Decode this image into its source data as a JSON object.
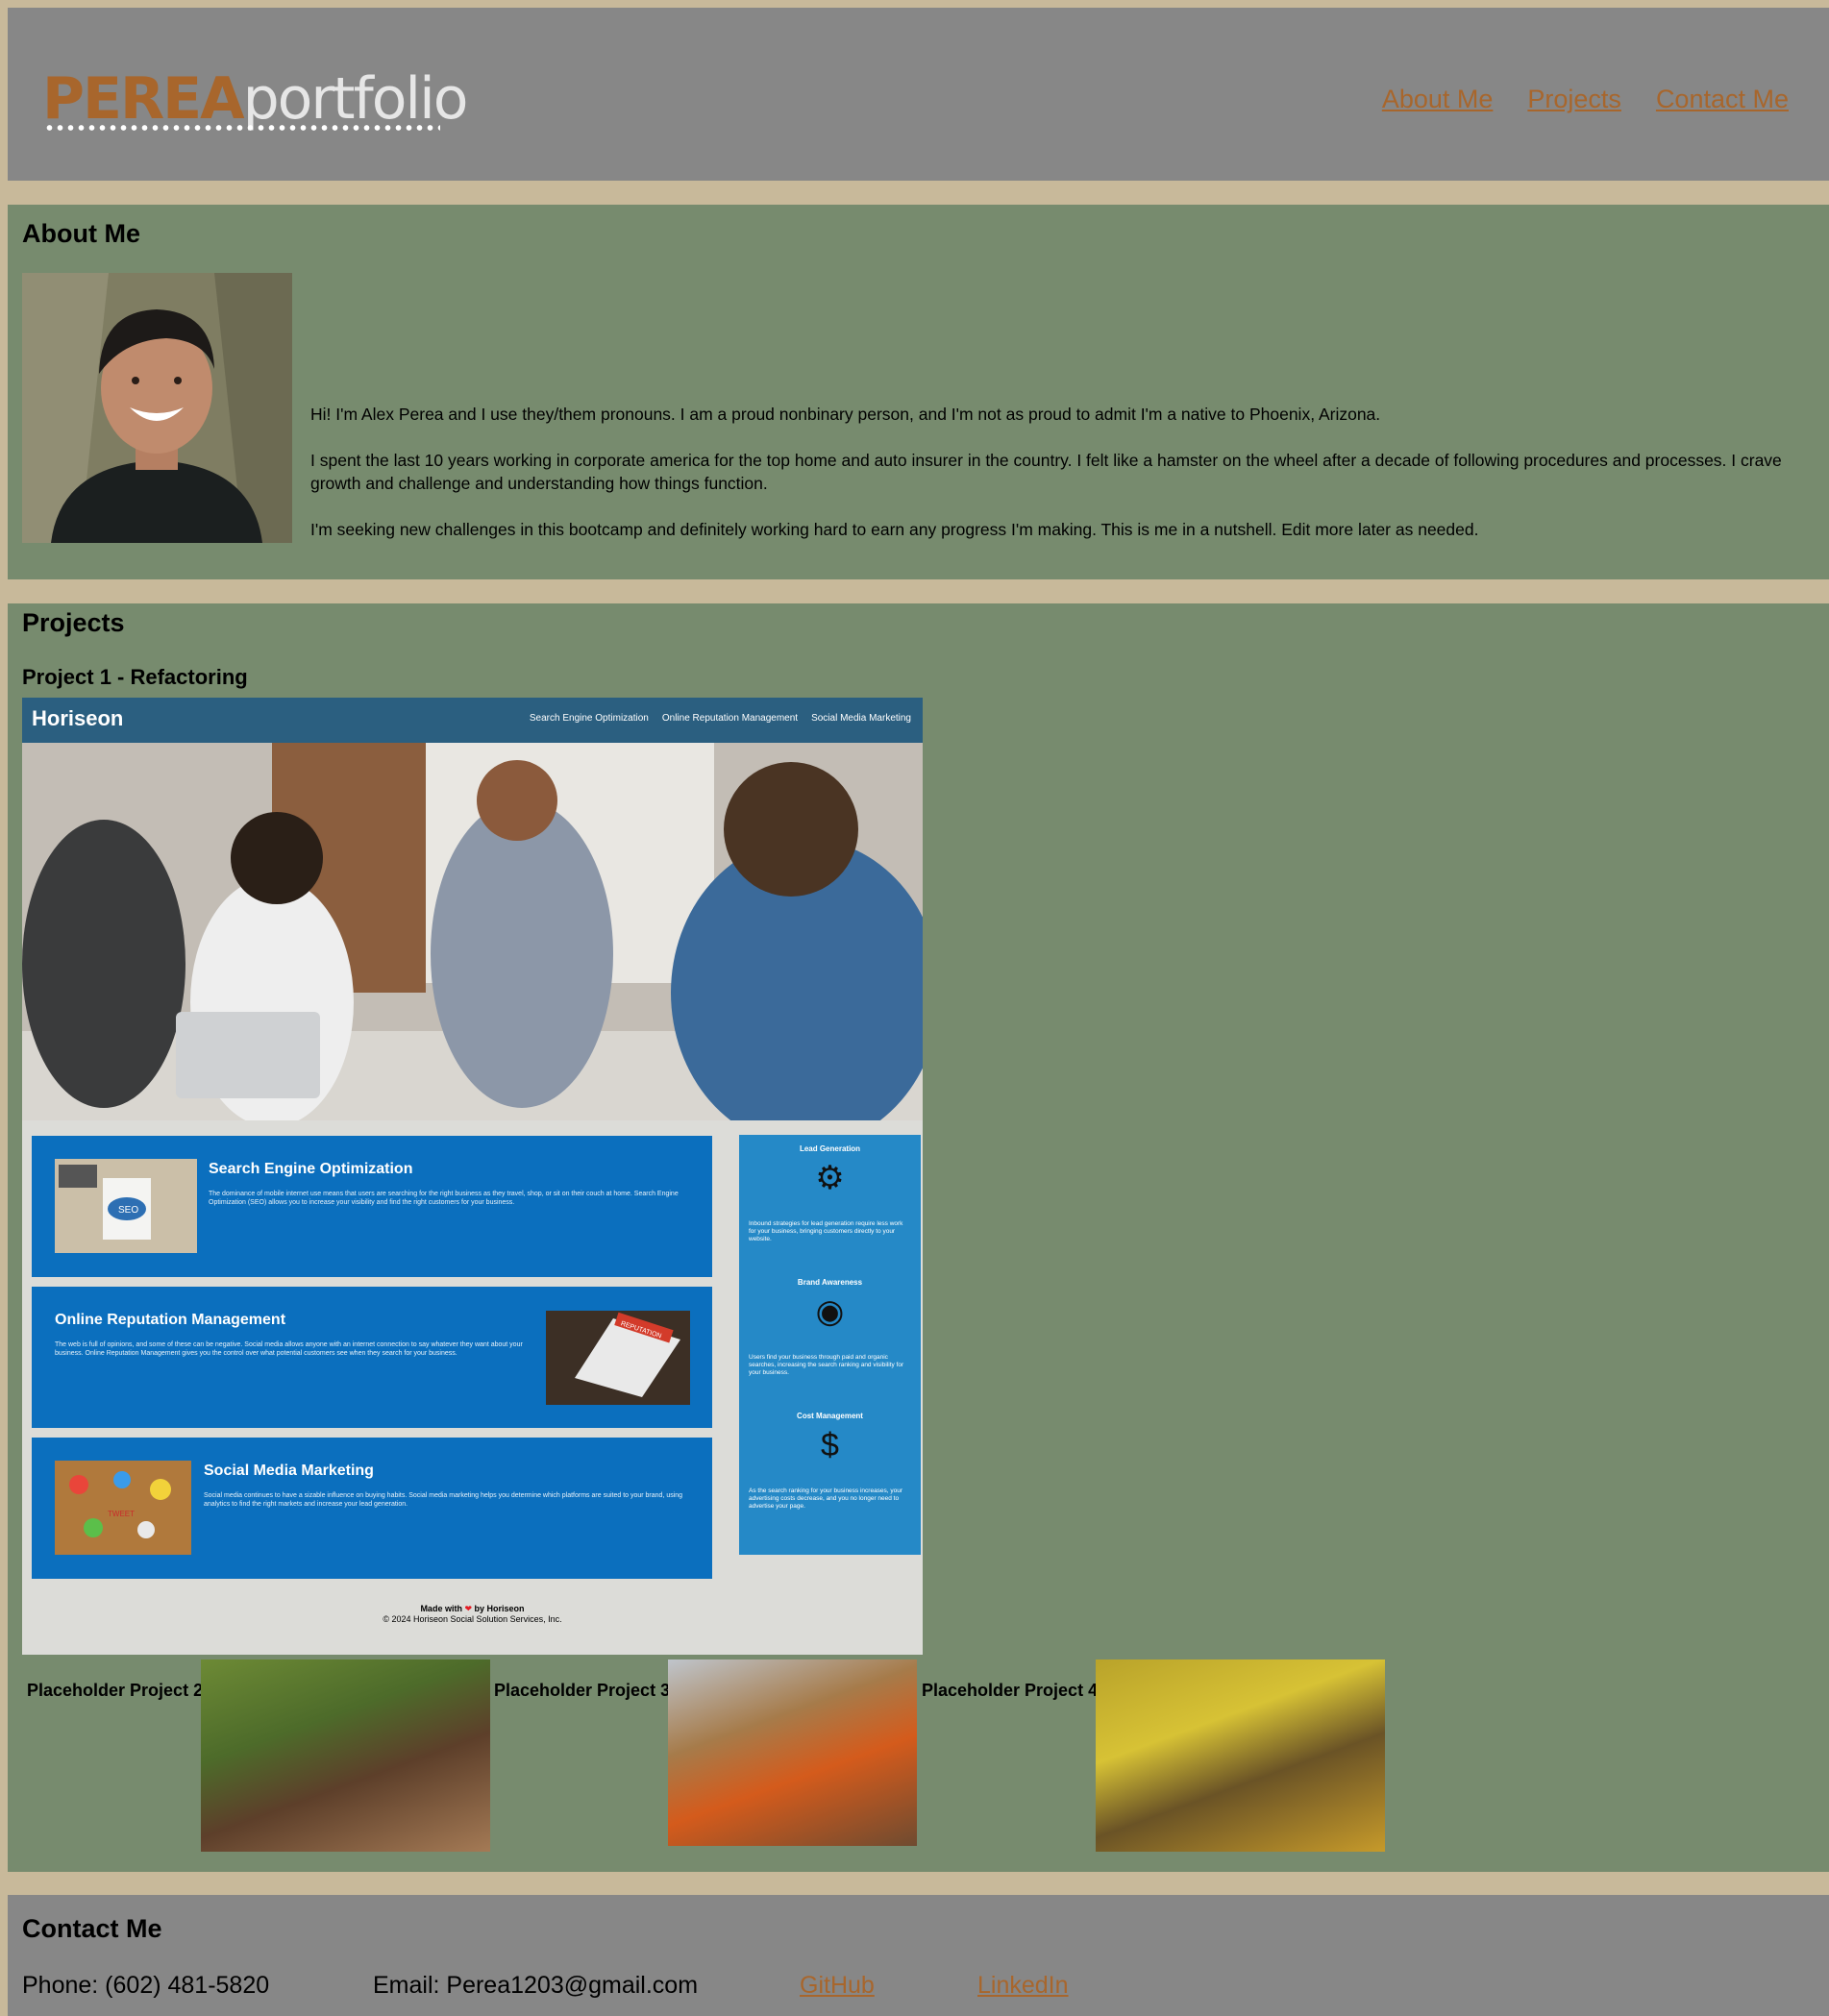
{
  "header": {
    "logo_brand": "PEREA",
    "logo_suffix": "portfolio",
    "nav": [
      "About Me",
      "Projects",
      "Contact Me"
    ]
  },
  "about": {
    "title": "About Me",
    "paragraphs": [
      "Hi! I'm Alex Perea and I use they/them pronouns. I am a proud nonbinary person, and I'm not as proud to admit I'm a native to Phoenix, Arizona.",
      "I spent the last 10 years working in corporate america for the top home and auto insurer in the country. I felt like a hamster on the wheel after a decade of following procedures and processes. I crave growth and challenge and understanding how things function.",
      "I'm seeking new challenges in this bootcamp and definitely working hard to earn any progress I'm making. This is me in a nutshell. Edit more later as needed."
    ]
  },
  "projects": {
    "title": "Projects",
    "project1": {
      "title": "Project 1 - Refactoring",
      "screenshot": {
        "logo": "Horiseon",
        "nav": [
          "Search Engine Optimization",
          "Online Reputation Management",
          "Social Media Marketing"
        ],
        "cards": [
          {
            "title": "Search Engine Optimization",
            "body": "The dominance of mobile internet use means that users are searching for the right business as they travel, shop, or sit on their couch at home. Search Engine Optimization (SEO) allows you to increase your visibility and find the right customers for your business."
          },
          {
            "title": "Online Reputation Management",
            "body": "The web is full of opinions, and some of these can be negative. Social media allows anyone with an internet connection to say whatever they want about your business. Online Reputation Management gives you the control over what potential customers see when they search for your business."
          },
          {
            "title": "Social Media Marketing",
            "body": "Social media continues to have a sizable influence on buying habits. Social media marketing helps you determine which platforms are suited to your brand, using analytics to find the right markets and increase your lead generation."
          }
        ],
        "thumb_seo": "SEO",
        "thumb_rep": "REPUTATION",
        "thumb_tweet": "TWEET",
        "side": [
          {
            "title": "Lead Generation",
            "icon": "lightbulb-icon",
            "text": "Inbound strategies for lead generation require less work for your business, bringing customers directly to your website."
          },
          {
            "title": "Brand Awareness",
            "icon": "broadcast-icon",
            "text": "Users find your business through paid and organic searches, increasing the search ranking and visibility for your business."
          },
          {
            "title": "Cost Management",
            "icon": "money-gear-icon",
            "text": "As the search ranking for your business increases, your advertising costs decrease, and you no longer need to advertise your page."
          }
        ],
        "footer_made": "Made with",
        "footer_by": "by Horiseon",
        "footer_copy": "© 2024 Horiseon Social Solution Services, Inc."
      }
    },
    "placeholders": [
      "Placeholder Project 2",
      "Placeholder Project 3",
      "Placeholder Project 4"
    ]
  },
  "contact": {
    "title": "Contact Me",
    "phone": "Phone: (602) 481-5820",
    "email": "Email: Perea1203@gmail.com",
    "github": "GitHub",
    "linkedin": "LinkedIn"
  },
  "colors": {
    "page_bg": "#c8b99a",
    "header_bg": "#878787",
    "section_bg": "#778b6e",
    "accent": "#a8662c",
    "horiseon_header": "#2b5f80",
    "horiseon_card": "#0b6fbe",
    "horiseon_side": "#2589c7"
  }
}
